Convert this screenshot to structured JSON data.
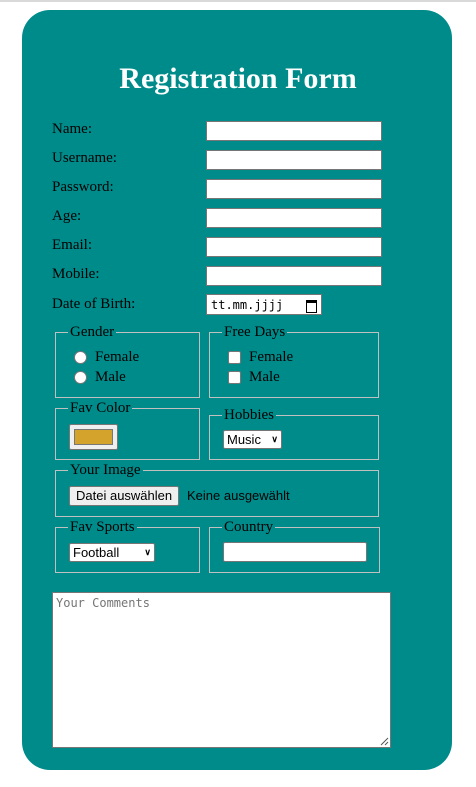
{
  "form": {
    "title": "Registration Form",
    "fields": [
      {
        "label": "Name:",
        "value": ""
      },
      {
        "label": "Username:",
        "value": ""
      },
      {
        "label": "Password:",
        "value": ""
      },
      {
        "label": "Age:",
        "value": ""
      },
      {
        "label": "Email:",
        "value": ""
      },
      {
        "label": "Mobile:",
        "value": ""
      }
    ],
    "dob": {
      "label": "Date of Birth:",
      "placeholder": "tt.mm.jjjj"
    },
    "gender": {
      "legend": "Gender",
      "options": [
        "Female",
        "Male"
      ]
    },
    "free_days": {
      "legend": "Free Days",
      "options": [
        "Female",
        "Male"
      ]
    },
    "fav_color": {
      "legend": "Fav Color",
      "value": "#d4a32b"
    },
    "hobbies": {
      "legend": "Hobbies",
      "selected": "Music"
    },
    "your_image": {
      "legend": "Your Image",
      "button_label": "Datei auswählen",
      "status": "Keine ausgewählt"
    },
    "fav_sports": {
      "legend": "Fav Sports",
      "selected": "Football"
    },
    "country": {
      "legend": "Country",
      "value": ""
    },
    "comments": {
      "placeholder": "Your Comments"
    }
  },
  "colors": {
    "card_background": "#008b8b",
    "title_text": "#ffffff"
  }
}
